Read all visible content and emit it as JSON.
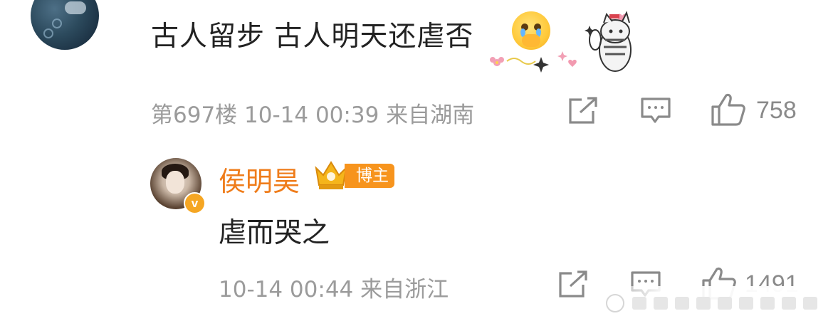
{
  "comment": {
    "text": "古人留步 古人明天还虐否",
    "floor": "第697楼",
    "time": "10-14 00:39",
    "location": "来自湖南",
    "like_count": "758",
    "emoji": "crying-face-emoji",
    "sticker": "cat-sticker"
  },
  "reply": {
    "username": "侯明昊",
    "badge_label": "博主",
    "verified_icon": "verified-v-icon",
    "text": "虐而哭之",
    "time": "10-14 00:44",
    "location": "来自浙江",
    "like_count": "1491"
  },
  "icons": {
    "share": "share-icon",
    "comment": "comment-icon",
    "like": "thumbs-up-icon",
    "crown": "crown-icon"
  },
  "colors": {
    "username": "#ef7c1a",
    "badge": "#f7941d",
    "meta_text": "#9b9b9b",
    "body_text": "#222222",
    "icon": "#8a8a8a"
  }
}
